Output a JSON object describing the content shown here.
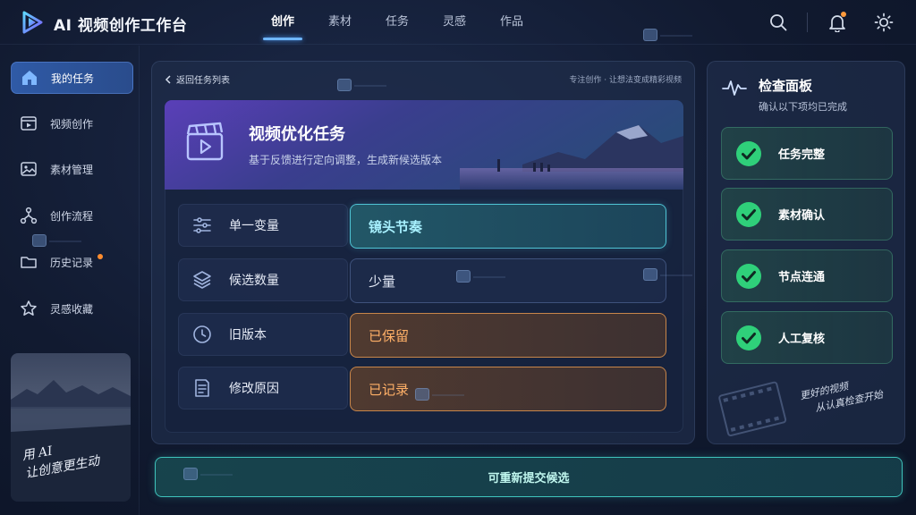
{
  "app": {
    "title": "AI 视频创作工作台"
  },
  "nav": {
    "items": [
      {
        "label": "创作",
        "active": true
      },
      {
        "label": "素材"
      },
      {
        "label": "任务"
      },
      {
        "label": "灵感"
      },
      {
        "label": "作品"
      }
    ]
  },
  "topbar": {
    "icons": [
      "search-icon",
      "bell-icon",
      "sun-icon"
    ],
    "notification_color": "#ff9a3c"
  },
  "sidebar": {
    "items": [
      {
        "label": "我的任务",
        "icon": "home-icon",
        "active": true
      },
      {
        "label": "视频创作",
        "icon": "video-icon"
      },
      {
        "label": "素材管理",
        "icon": "image-icon"
      },
      {
        "label": "创作流程",
        "icon": "flow-icon"
      },
      {
        "label": "历史记录",
        "icon": "folder-icon",
        "badge": true
      },
      {
        "label": "灵感收藏",
        "icon": "star-icon"
      }
    ],
    "card_text": [
      "用 AI",
      "让创意更生动"
    ]
  },
  "main": {
    "back_label": "返回任务列表",
    "slogan": "专注创作 · 让想法变成精彩视频",
    "hero": {
      "title": "视频优化任务",
      "subtitle": "基于反馈进行定向调整，生成新候选版本"
    },
    "rows": [
      {
        "label": "单一变量",
        "value": "镜头节奏",
        "icon": "sliders-icon",
        "style": "teal"
      },
      {
        "label": "候选数量",
        "value": "少量",
        "icon": "layers-icon",
        "style": "plain"
      },
      {
        "label": "旧版本",
        "value": "已保留",
        "icon": "clock-icon",
        "style": "amber"
      },
      {
        "label": "修改原因",
        "value": "已记录",
        "icon": "document-icon",
        "style": "amber"
      }
    ]
  },
  "check_panel": {
    "title": "检查面板",
    "subtitle": "确认以下项均已完成",
    "items": [
      {
        "label": "任务完整",
        "status": "done"
      },
      {
        "label": "素材确认",
        "status": "done"
      },
      {
        "label": "节点连通",
        "status": "done"
      },
      {
        "label": "人工复核",
        "status": "done"
      }
    ],
    "handwriting": [
      "更好的视频",
      "从认真检查开始"
    ]
  },
  "submit_label": "可重新提交候选",
  "colors": {
    "accent": "#6fb6ff",
    "teal": "#4fc3d4",
    "amber": "#ffb067",
    "check": "#2fd07a"
  }
}
